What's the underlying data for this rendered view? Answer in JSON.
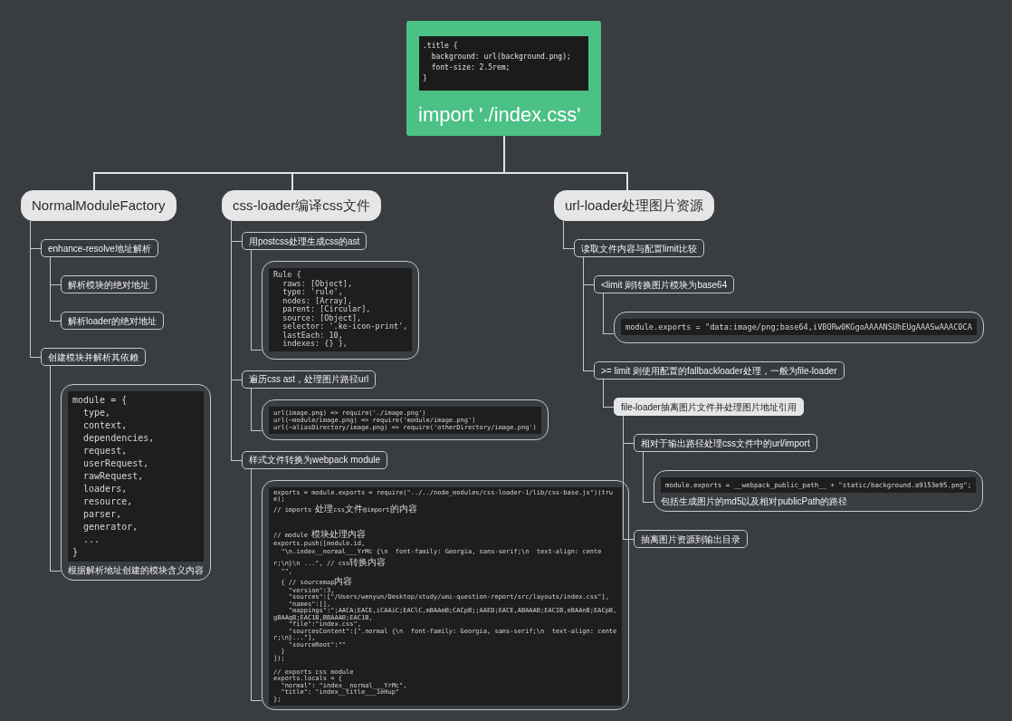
{
  "central_topic": {
    "code": ".title {\n  background: url(background.png);\n  font-size: 2.5rem;\n}",
    "title": "import './index.css'"
  },
  "branches": [
    {
      "label": "NormalModuleFactory",
      "children": [
        {
          "kind": "topic",
          "label": "enhance-resolve地址解析",
          "selected": false,
          "children": [
            {
              "kind": "topic",
              "label": "解析模块的绝对地址",
              "selected": false
            },
            {
              "kind": "topic",
              "label": "解析loader的绝对地址",
              "selected": false
            }
          ]
        },
        {
          "kind": "topic",
          "label": "创建模块并解析其依赖",
          "selected": false,
          "children": [
            {
              "kind": "code_note",
              "code": "module = {\n  type,\n  context,\n  dependencies,\n  request,\n  userRequest,\n  rawRequest,\n  loaders,\n  resource,\n  parser,\n  generator,\n  ...\n}",
              "note": "根据解析地址创建的模块含义内容"
            }
          ]
        }
      ]
    },
    {
      "label": "css-loader编译css文件",
      "children": [
        {
          "kind": "topic",
          "label": "用postcss处理生成css的ast",
          "selected": false,
          "children": [
            {
              "kind": "code",
              "code": "Rule {\n  raws: [Object],\n  type: 'rule',\n  nodes: [Array],\n  parent: [Circular],\n  source: [Object],\n  selector: '.ke-icon-print',\n  lastEach: 10,\n  indexes: {} },"
            }
          ]
        },
        {
          "kind": "topic",
          "label": "遍历css ast，处理图片路径url",
          "selected": false,
          "children": [
            {
              "kind": "code",
              "code": "url(image.png) => require('./image.png')\nurl(~module/image.png) => require('module/image.png')\nurl(~aliasDirectory/image.png) => require('otherDirectory/image.png')"
            }
          ]
        },
        {
          "kind": "topic",
          "label": "样式文件转换为webpack module",
          "selected": false,
          "children": [
            {
              "kind": "code",
              "code": "exports = module.exports = require(\"../../node_modules/css-loader-1/lib/css-base.js\")(true);\n// imports 处理css文件@import的内容\n\n\n// module 模块处理内容\nexports.push([module.id,\n  \"\\n.index__normal___YrMc {\\n  font-family: Georgia, sans-serif;\\n  text-align: center;\\n}\\n ...\", // css转换内容\n  \"\",\n  { // sourcemap内容\n    \"version\":3,\n    \"sources\":[\"/Users/wenyun/Desktop/study/umi-question-report/src/layouts/index.css\"],\n    \"names\":[],\n    \"mappings\":\";AACA;EACE,iCAAiC;EAClC,mBAAmB;CACpB;;AAED;EACE,ABAAAB;EAC1B,eBAAnB;EACpB,gBAAqB;EAC1B,BBAAAB;EAC1B,\n    \"file\":\"index.css\",\n    \"sourcesContent\":[\".normal {\\n  font-family: Georgia, sans-serif;\\n  text-align: center;\\n}...\"],\n    \"sourceRoot\":\"\"\n  }\n]);\n\n// exports css module\nexports.locals = {\n  \"normal\": \"index__normal___YrMc\",\n  \"title\": \"index__title___1eHup\"\n};"
            }
          ]
        }
      ]
    },
    {
      "label": "url-loader处理图片资源",
      "children": [
        {
          "kind": "topic",
          "label": "读取文件内容与配置limit比较",
          "selected": false,
          "children": [
            {
              "kind": "topic",
              "label": "<limit 则转换图片模块为base64",
              "selected": false,
              "children": [
                {
                  "kind": "code",
                  "code": "module.exports = \"data:image/png;base64,iVBORw0KGgoAAAANSUhEUgAAASwAAAC0CA"
                }
              ]
            },
            {
              "kind": "topic",
              "label": ">= limit 则使用配置的fallbackloader处理，一般为file-loader",
              "selected": false,
              "children": [
                {
                  "kind": "topic",
                  "label": "file-loader抽离图片文件并处理图片地址引用",
                  "selected": true,
                  "children": [
                    {
                      "kind": "topic",
                      "label": "相对于输出路径处理css文件中的url/import",
                      "selected": false,
                      "children": [
                        {
                          "kind": "code_note",
                          "code": "module.exports = __webpack_public_path__ + \"static/background.a9153e95.png\";",
                          "note": "包括生成图片的md5以及相对publicPath的路径"
                        }
                      ]
                    },
                    {
                      "kind": "topic",
                      "label": "抽离图片资源到输出目录",
                      "selected": false
                    }
                  ]
                }
              ]
            }
          ]
        }
      ]
    }
  ]
}
